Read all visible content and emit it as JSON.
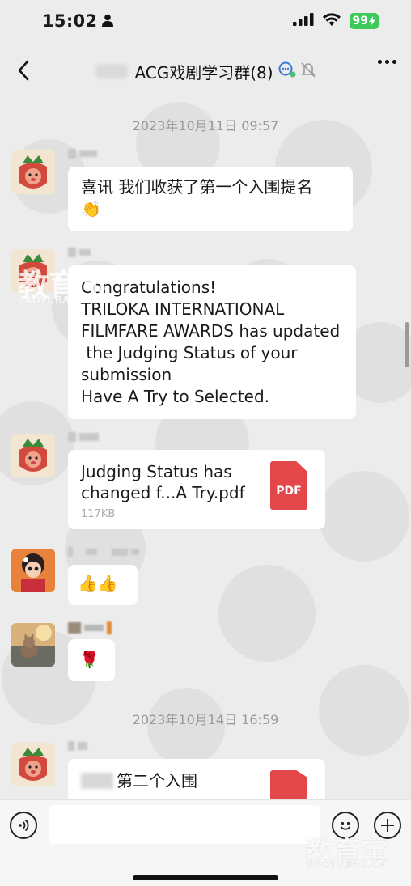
{
  "status_bar": {
    "time": "15:02",
    "battery": "99"
  },
  "nav": {
    "title": "ACG戏剧学习群(8)"
  },
  "chat": {
    "timestamps": [
      "2023年10月11日 09:57",
      "2023年10月14日 16:59"
    ],
    "messages": [
      {
        "text": "喜讯 我们收获了第一个入围提名",
        "emoji": "👏"
      },
      {
        "lines": [
          "Congratulations!",
          "TRILOKA INTERNATIONAL",
          "FILMFARE AWARDS has updated",
          " the Judging Status of your",
          "submission",
          "Have A Try to Selected."
        ]
      },
      {
        "file_name": "Judging Status has changed f...A Try.pdf",
        "file_size": "117KB",
        "file_type": "PDF"
      },
      {
        "emoji": "👍👍"
      },
      {
        "emoji": "🌹"
      },
      {
        "text": "第二个入围"
      }
    ]
  },
  "watermark": {
    "brand": "教育宝",
    "site": "JIAOYUBAO.CN"
  },
  "icons": {
    "back": "chevron-left-icon",
    "more": "more-dots-icon",
    "voice": "voice-icon",
    "emoji": "emoji-icon",
    "plus": "plus-icon",
    "person": "person-icon",
    "wifi": "wifi-icon",
    "signal": "signal-icon",
    "mute": "bell-off-icon",
    "group": "group-chat-icon"
  },
  "colors": {
    "background": "#ececec",
    "bubble": "#ffffff",
    "battery": "#3ec95a",
    "pdf": "#e4474a",
    "timestamp": "#999999"
  }
}
